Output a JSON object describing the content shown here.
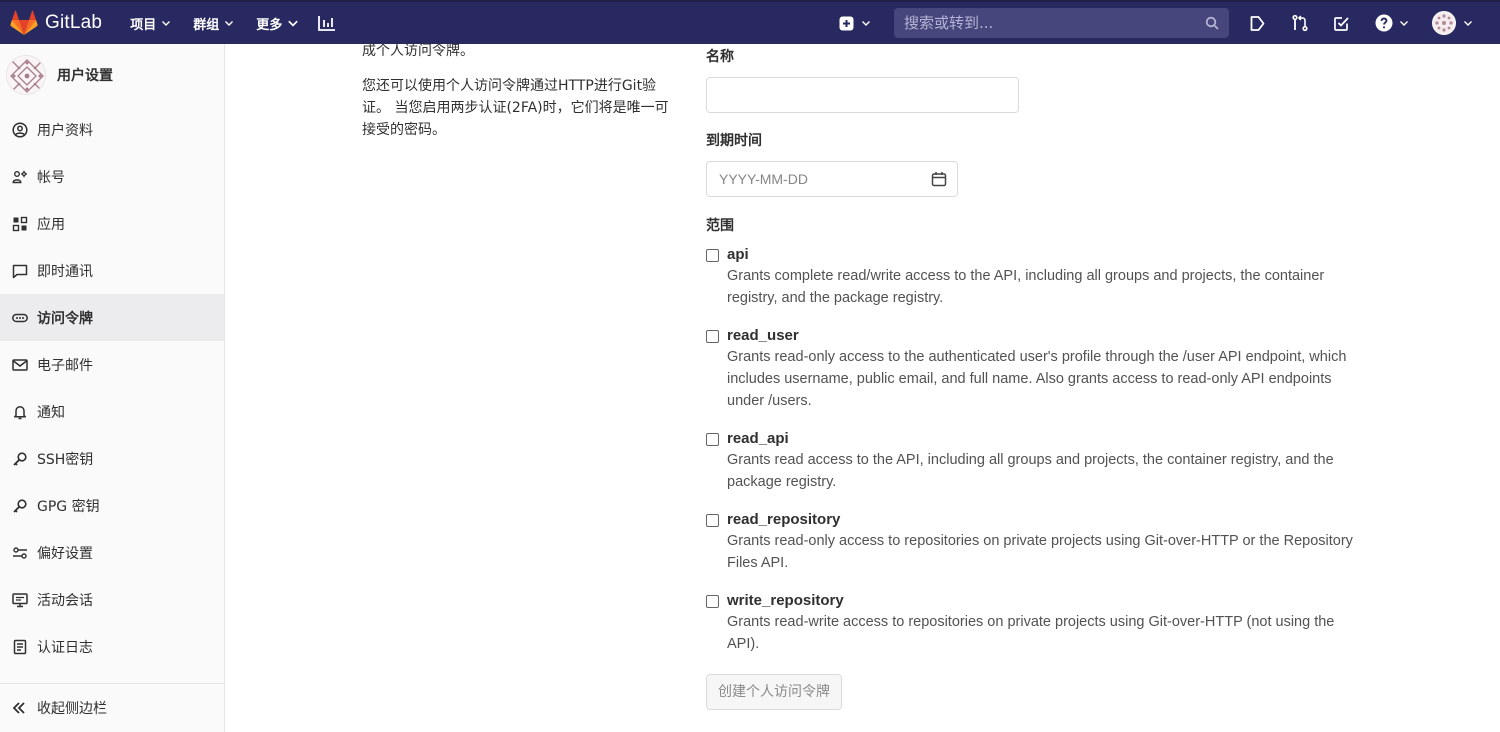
{
  "navbar": {
    "brand": "GitLab",
    "menu": [
      {
        "label": "项目",
        "icon": "chevron-down-icon"
      },
      {
        "label": "群组",
        "icon": "chevron-down-icon"
      },
      {
        "label": "更多",
        "icon": "chevron-down-icon"
      }
    ],
    "search_placeholder": "搜索或转到...",
    "icons": [
      "plus-square-icon",
      "search-icon",
      "todo-icon",
      "merge-request-icon",
      "issues-icon",
      "help-icon",
      "avatar"
    ],
    "bg_color": "#292961"
  },
  "sidebar": {
    "title": "用户设置",
    "items": [
      {
        "label": "用户资料",
        "icon": "profile-icon",
        "active": false
      },
      {
        "label": "帐号",
        "icon": "account-icon",
        "active": false
      },
      {
        "label": "应用",
        "icon": "applications-icon",
        "active": false
      },
      {
        "label": "即时通讯",
        "icon": "chat-icon",
        "active": false
      },
      {
        "label": "访问令牌",
        "icon": "token-icon",
        "active": true
      },
      {
        "label": "电子邮件",
        "icon": "mail-icon",
        "active": false
      },
      {
        "label": "通知",
        "icon": "notification-icon",
        "active": false
      },
      {
        "label": "SSH密钥",
        "icon": "key-icon",
        "active": false
      },
      {
        "label": "GPG 密钥",
        "icon": "key-icon",
        "active": false
      },
      {
        "label": "偏好设置",
        "icon": "preferences-icon",
        "active": false
      },
      {
        "label": "活动会话",
        "icon": "monitor-icon",
        "active": false
      },
      {
        "label": "认证日志",
        "icon": "log-icon",
        "active": false
      }
    ],
    "collapse_label": "收起侧边栏"
  },
  "intro": {
    "line_cut": "成个人访问令牌。",
    "paragraph": "您还可以使用个人访问令牌通过HTTP进行Git验证。 当您启用两步认证(2FA)时，它们将是唯一可接受的密码。"
  },
  "form": {
    "name_label": "名称",
    "name_value": "",
    "expires_label": "到期时间",
    "expires_placeholder": "YYYY-MM-DD",
    "scopes_label": "范围",
    "scopes": [
      {
        "name": "api",
        "checked": false,
        "description": "Grants complete read/write access to the API, including all groups and projects, the container registry, and the package registry."
      },
      {
        "name": "read_user",
        "checked": false,
        "description": "Grants read-only access to the authenticated user's profile through the /user API endpoint, which includes username, public email, and full name. Also grants access to read-only API endpoints under /users."
      },
      {
        "name": "read_api",
        "checked": false,
        "description": "Grants read access to the API, including all groups and projects, the container registry, and the package registry."
      },
      {
        "name": "read_repository",
        "checked": false,
        "description": "Grants read-only access to repositories on private projects using Git-over-HTTP or the Repository Files API."
      },
      {
        "name": "write_repository",
        "checked": false,
        "description": "Grants read-write access to repositories on private projects using Git-over-HTTP (not using the API)."
      }
    ],
    "submit_label": "创建个人访问令牌"
  }
}
